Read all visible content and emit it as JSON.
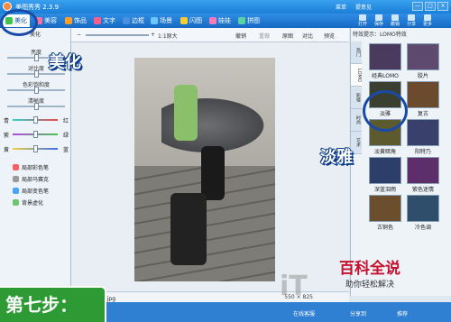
{
  "app": {
    "title": "美图秀秀 2.3.9"
  },
  "title_links": [
    "菜单",
    "提意见"
  ],
  "window_buttons": [
    "—",
    "□",
    "×"
  ],
  "main_tabs": [
    {
      "label": "美化",
      "color": "#3ec24c"
    },
    {
      "label": "美容",
      "color": "#ff6fa0"
    },
    {
      "label": "饰品",
      "color": "#ff9f2a"
    },
    {
      "label": "文字",
      "color": "#ff5e8a"
    },
    {
      "label": "边框",
      "color": "#4a90e2"
    },
    {
      "label": "场景",
      "color": "#6cc7ff"
    },
    {
      "label": "闪图",
      "color": "#ffcc33"
    },
    {
      "label": "娃娃",
      "color": "#ff7ab8"
    },
    {
      "label": "拼图",
      "color": "#5bd1a6"
    }
  ],
  "quick_tools": [
    "打开",
    "保存",
    "撤销",
    "分享",
    "更多"
  ],
  "left_panel": {
    "header": "美化",
    "sliders": [
      {
        "label": "亮度",
        "value": 0.5
      },
      {
        "label": "对比度",
        "value": 0.5
      },
      {
        "label": "色彩饱和度",
        "value": 0.5
      },
      {
        "label": "清晰度",
        "value": 0.5
      }
    ],
    "color_sliders": [
      {
        "left": "青",
        "right": "红",
        "value": 0.5,
        "gradient": "linear-gradient(90deg,#33d1d1,#e84b4b)"
      },
      {
        "left": "紫",
        "right": "绿",
        "value": 0.5,
        "gradient": "linear-gradient(90deg,#b04be0,#4cc44c)"
      },
      {
        "left": "黄",
        "right": "蓝",
        "value": 0.5,
        "gradient": "linear-gradient(90deg,#f0d23a,#3a6ff0)"
      }
    ],
    "brushes": [
      {
        "label": "局部彩色笔",
        "color": "#ff5f5f"
      },
      {
        "label": "局部马赛克",
        "color": "#9a9a9a"
      },
      {
        "label": "局部变色笔",
        "color": "#4aa3ff"
      },
      {
        "label": "背景虚化",
        "color": "#6cc76c"
      }
    ]
  },
  "canvas_toolbar": {
    "ratio": "1:1原大",
    "actions": [
      "撤销",
      "重做",
      "原图",
      "对比",
      "预览"
    ]
  },
  "status": {
    "file_name": "1_副本_副本.jpg",
    "dims": "550 × 825"
  },
  "right_panel": {
    "header": "特效提示：LOMO特效",
    "vertical_tabs": [
      "热门",
      "LOMO",
      "影楼",
      "时尚",
      "艺术"
    ],
    "effects": [
      {
        "label": "经典LOMO",
        "color": "#4a3b5e"
      },
      {
        "label": "胶片",
        "color": "#5e4a6e"
      },
      {
        "label": "淡雅",
        "color": "#3a3f30"
      },
      {
        "label": "复古",
        "color": "#6b4a2e"
      },
      {
        "label": "淡黄暗角",
        "color": "#5c5a2e"
      },
      {
        "label": "阳特乃",
        "color": "#38406b"
      },
      {
        "label": "深蓝泪雨",
        "color": "#2e3e6b"
      },
      {
        "label": "紫色迷情",
        "color": "#5e2e6b"
      },
      {
        "label": "古铜色",
        "color": "#6b4e2e"
      },
      {
        "label": "冷色调",
        "color": "#2e4e6b"
      }
    ]
  },
  "annotations": {
    "beautify": "美化",
    "elegant": "淡雅",
    "step": "第七步："
  },
  "watermark": {
    "title": "百科全说",
    "subtitle": "助你轻松解决",
    "site": "iT"
  },
  "bottom_status": [
    "在线客服",
    "分享到",
    "推荐"
  ]
}
